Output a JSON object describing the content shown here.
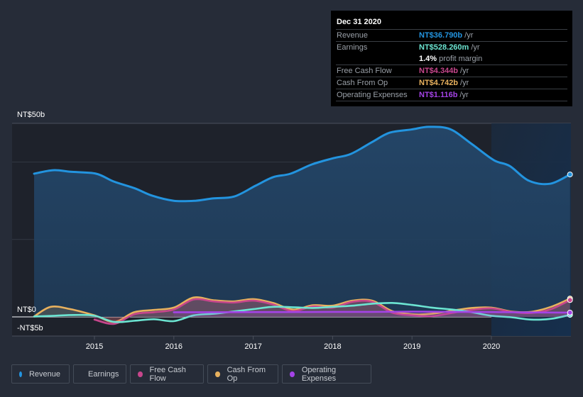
{
  "tooltip": {
    "date": "Dec 31 2020",
    "rows": [
      {
        "label": "Revenue",
        "value": "NT$36.790b",
        "unit": "/yr",
        "color": "#2394df"
      },
      {
        "label": "Earnings",
        "value": "NT$528.260m",
        "unit": "/yr",
        "color": "#6ce5d2"
      },
      {
        "label": "",
        "value": "1.4%",
        "unit": "profit margin",
        "color": "#ffffff"
      },
      {
        "label": "Free Cash Flow",
        "value": "NT$4.344b",
        "unit": "/yr",
        "color": "#c7468c"
      },
      {
        "label": "Cash From Op",
        "value": "NT$4.742b",
        "unit": "/yr",
        "color": "#e8b15e"
      },
      {
        "label": "Operating Expenses",
        "value": "NT$1.116b",
        "unit": "/yr",
        "color": "#a443e6"
      }
    ]
  },
  "legend": [
    {
      "label": "Revenue",
      "color": "#2394df"
    },
    {
      "label": "Earnings",
      "color": "#6ce5d2"
    },
    {
      "label": "Free Cash Flow",
      "color": "#c7468c"
    },
    {
      "label": "Cash From Op",
      "color": "#e8b15e"
    },
    {
      "label": "Operating Expenses",
      "color": "#a443e6"
    }
  ],
  "chart_data": {
    "type": "line",
    "title": "",
    "xlabel": "",
    "ylabel": "",
    "y_tick_labels": [
      "NT$50b",
      "NT$0",
      "-NT$5b"
    ],
    "x_tick_labels": [
      "2015",
      "2016",
      "2017",
      "2018",
      "2019",
      "2020"
    ],
    "x_ticks": [
      2015,
      2016,
      2017,
      2018,
      2019,
      2020
    ],
    "xlim": [
      2014.0,
      2021.0
    ],
    "ylim": [
      -5,
      50
    ],
    "gridlines_y": [
      50,
      40,
      20,
      0
    ],
    "highlight_range": [
      2020.0,
      2021.0
    ],
    "legend_position": "bottom-left",
    "series": [
      {
        "name": "Revenue",
        "color": "#2394df",
        "fill": true,
        "x": [
          2014.24,
          2014.48,
          2014.7,
          2015.02,
          2015.24,
          2015.51,
          2015.73,
          2016.0,
          2016.27,
          2016.49,
          2016.76,
          2017.03,
          2017.25,
          2017.47,
          2017.74,
          2018.01,
          2018.23,
          2018.5,
          2018.72,
          2018.99,
          2019.21,
          2019.48,
          2019.75,
          2020.03,
          2020.23,
          2020.47,
          2020.74,
          2020.99
        ],
        "values": [
          37.0,
          37.9,
          37.5,
          37.0,
          35.0,
          33.2,
          31.3,
          30.0,
          30.0,
          30.6,
          31.1,
          33.9,
          36.1,
          37.0,
          39.4,
          41.0,
          42.1,
          45.2,
          47.6,
          48.4,
          49.1,
          48.5,
          44.7,
          40.5,
          39.0,
          35.2,
          34.4,
          36.8
        ]
      },
      {
        "name": "Earnings",
        "color": "#6ce5d2",
        "fill": false,
        "x": [
          2014.24,
          2014.5,
          2014.75,
          2015.0,
          2015.25,
          2015.5,
          2015.75,
          2016.0,
          2016.25,
          2016.5,
          2016.75,
          2017.0,
          2017.25,
          2017.5,
          2017.75,
          2018.0,
          2018.25,
          2018.5,
          2018.75,
          2019.0,
          2019.25,
          2019.5,
          2019.75,
          2020.0,
          2020.25,
          2020.5,
          2020.75,
          2020.99
        ],
        "values": [
          0.1,
          0.3,
          0.5,
          0.3,
          -1.3,
          -1.0,
          -0.6,
          -1.1,
          0.4,
          0.8,
          1.4,
          2.0,
          2.6,
          2.5,
          2.3,
          2.6,
          2.9,
          3.4,
          3.6,
          3.1,
          2.4,
          1.9,
          1.2,
          0.3,
          -0.1,
          -0.7,
          -0.5,
          0.53
        ]
      },
      {
        "name": "Free Cash Flow",
        "color": "#c7468c",
        "fill": true,
        "x": [
          2015.0,
          2015.25,
          2015.5,
          2015.75,
          2016.0,
          2016.25,
          2016.5,
          2016.75,
          2017.0,
          2017.25,
          2017.5,
          2017.75,
          2018.0,
          2018.25,
          2018.5,
          2018.75,
          2019.0,
          2019.25,
          2019.5,
          2019.75,
          2020.0,
          2020.25,
          2020.5,
          2020.75,
          2020.99
        ],
        "values": [
          -0.7,
          -1.8,
          0.7,
          1.2,
          1.9,
          4.5,
          4.0,
          3.7,
          4.2,
          3.2,
          1.5,
          2.7,
          2.4,
          3.9,
          3.9,
          1.1,
          0.4,
          0.2,
          1.0,
          1.8,
          2.2,
          1.3,
          1.0,
          2.0,
          4.344
        ]
      },
      {
        "name": "Cash From Op",
        "color": "#e8b15e",
        "fill": true,
        "x": [
          2014.24,
          2014.45,
          2014.7,
          2015.0,
          2015.25,
          2015.5,
          2015.75,
          2016.0,
          2016.25,
          2016.5,
          2016.75,
          2017.0,
          2017.25,
          2017.5,
          2017.75,
          2018.0,
          2018.25,
          2018.5,
          2018.75,
          2019.0,
          2019.25,
          2019.5,
          2019.75,
          2020.0,
          2020.25,
          2020.5,
          2020.75,
          2020.99
        ],
        "values": [
          0.1,
          2.6,
          2.0,
          0.4,
          -1.3,
          1.2,
          1.8,
          2.4,
          5.0,
          4.3,
          4.0,
          4.6,
          3.6,
          1.9,
          3.0,
          2.9,
          4.2,
          4.2,
          1.5,
          0.7,
          0.8,
          1.6,
          2.3,
          2.4,
          1.4,
          1.3,
          2.6,
          4.742
        ]
      },
      {
        "name": "Operating Expenses",
        "color": "#a443e6",
        "fill": true,
        "x": [
          2016.0,
          2016.5,
          2017.0,
          2017.5,
          2018.0,
          2018.5,
          2019.0,
          2019.5,
          2020.0,
          2020.5,
          2020.99
        ],
        "values": [
          1.2,
          1.2,
          1.25,
          1.25,
          1.3,
          1.3,
          1.35,
          1.3,
          1.25,
          1.15,
          1.116
        ]
      }
    ]
  }
}
